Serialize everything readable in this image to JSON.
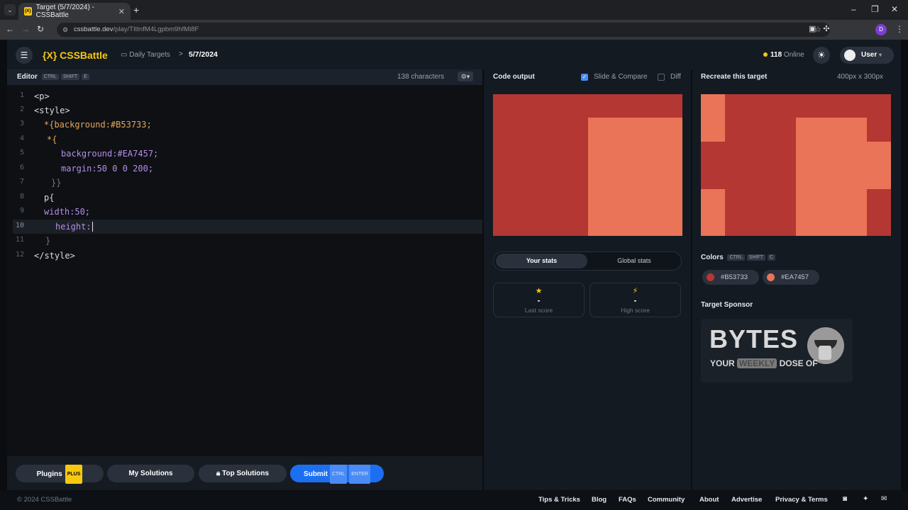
{
  "browser": {
    "tab_title": "Target (5/7/2024) - CSSBattle",
    "url_host": "cssbattle.dev",
    "url_path": "/play/TItInfM4Lgpbm9hfMi8F",
    "profile_initial": "D"
  },
  "header": {
    "logo": "{X} CSSBattle",
    "breadcrumb_parent": "Daily Targets",
    "breadcrumb_sep": ">",
    "breadcrumb_current": "5/7/2024",
    "online_count": "118",
    "online_label": "Online",
    "user_label": "User"
  },
  "editor": {
    "title": "Editor",
    "shortcut": [
      "CTRL",
      "SHIFT",
      "E"
    ],
    "char_count": "138 characters",
    "lines": [
      {
        "n": "1",
        "text": "<p>"
      },
      {
        "n": "2",
        "text": "<style>"
      },
      {
        "n": "3",
        "text": "*{background:#B53733;"
      },
      {
        "n": "4",
        "text": "*{"
      },
      {
        "n": "5",
        "text": "background:#EA7457;"
      },
      {
        "n": "6",
        "text": "margin:50 0 0 200;"
      },
      {
        "n": "7",
        "text": "}}"
      },
      {
        "n": "8",
        "text": "p{"
      },
      {
        "n": "9",
        "text": "width:50;"
      },
      {
        "n": "10",
        "text": "height:"
      },
      {
        "n": "11",
        "text": "}"
      },
      {
        "n": "12",
        "text": "</style>"
      }
    ]
  },
  "footer_buttons": {
    "plugins": "Plugins",
    "plus_badge": "PLUS",
    "my_solutions": "My Solutions",
    "top_solutions": "Top Solutions",
    "submit": "Submit",
    "submit_keys": [
      "CTRL",
      "ENTER"
    ]
  },
  "output": {
    "title": "Code output",
    "slide_compare": "Slide & Compare",
    "slide_compare_checked": true,
    "diff": "Diff",
    "diff_checked": false,
    "tabs": [
      "Your stats",
      "Global stats"
    ],
    "stats": [
      {
        "icon": "star-icon",
        "value": "-",
        "label": "Last score"
      },
      {
        "icon": "bolt-icon",
        "value": "-",
        "label": "High score"
      }
    ]
  },
  "target": {
    "title": "Recreate this target",
    "size": "400px x 300px",
    "colors_title": "Colors",
    "colors_shortcut": [
      "CTRL",
      "SHIFT",
      "C"
    ],
    "colors": [
      "#B53733",
      "#EA7457"
    ],
    "sponsor_title": "Target Sponsor",
    "sponsor_name": "BYTES",
    "sponsor_tagline_1": "YOUR",
    "sponsor_tagline_2": "WEEKLY",
    "sponsor_tagline_3": "DOSE OF"
  },
  "footer": {
    "copyright": "© 2024 CSSBattle",
    "links": [
      "Tips & Tricks",
      "Blog",
      "FAQs",
      "Community",
      "About",
      "Advertise",
      "Privacy & Terms"
    ]
  },
  "theme": {
    "bg": "#B53733",
    "fg": "#EA7457",
    "accent": "#F6C90E",
    "submit": "#1D6FF2"
  }
}
